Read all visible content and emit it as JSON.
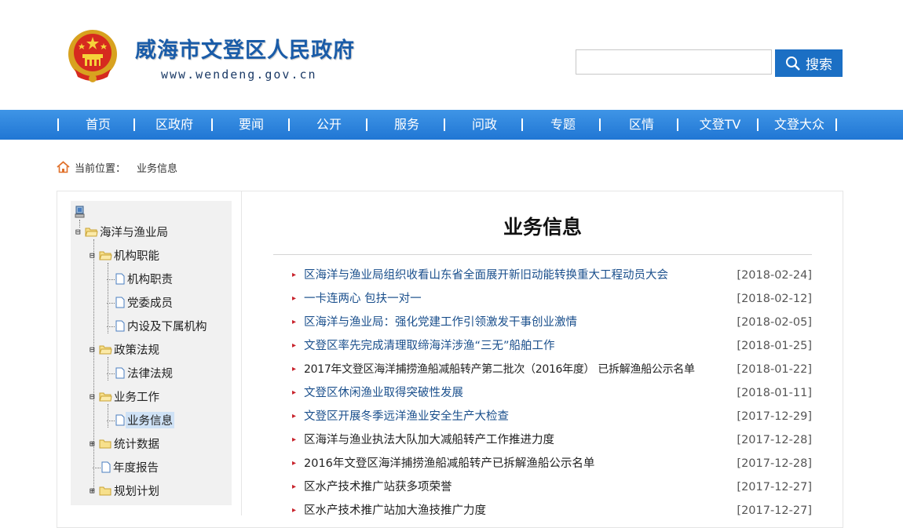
{
  "header": {
    "site_title": "威海市文登区人民政府",
    "site_url": "www.wendeng.gov.cn",
    "emblem_icon": "national-emblem-icon",
    "search": {
      "value": "",
      "placeholder": "",
      "button_label": "搜索",
      "icon": "search-icon"
    }
  },
  "nav": {
    "items": [
      "首页",
      "区政府",
      "要闻",
      "公开",
      "服务",
      "问政",
      "专题",
      "区情",
      "文登TV",
      "文登大众"
    ]
  },
  "breadcrumb": {
    "icon": "home-icon",
    "prefix": "当前位置：",
    "current": "业务信息"
  },
  "sidebar": {
    "root_icon": "computer-icon",
    "items": [
      {
        "label": "海洋与渔业局",
        "type": "folder",
        "expanded": true
      },
      {
        "label": "机构职能",
        "type": "folder",
        "expanded": true
      },
      {
        "label": "机构职责",
        "type": "page"
      },
      {
        "label": "党委成员",
        "type": "page"
      },
      {
        "label": "内设及下属机构",
        "type": "page"
      },
      {
        "label": "政策法规",
        "type": "folder",
        "expanded": true
      },
      {
        "label": "法律法规",
        "type": "page"
      },
      {
        "label": "业务工作",
        "type": "folder",
        "expanded": true
      },
      {
        "label": "业务信息",
        "type": "page",
        "selected": true
      },
      {
        "label": "统计数据",
        "type": "folder",
        "expanded": false
      },
      {
        "label": "年度报告",
        "type": "page"
      },
      {
        "label": "规划计划",
        "type": "folder",
        "expanded": false
      }
    ]
  },
  "main": {
    "title": "业务信息",
    "bullet": "▸",
    "news": [
      {
        "title": "区海洋与渔业局组织收看山东省全面展开新旧动能转换重大工程动员大会",
        "date": "[2018-02-24]"
      },
      {
        "title": "一卡连两心 包扶一对一",
        "date": "[2018-02-12]"
      },
      {
        "title": "区海洋与渔业局：强化党建工作引领激发干事创业激情",
        "date": "[2018-02-05]"
      },
      {
        "title": "文登区率先完成清理取缔海洋涉渔“三无”船舶工作",
        "date": "[2018-01-25]"
      },
      {
        "title": "2017年文登区海洋捕捞渔船减船转产第二批次（2016年度） 已拆解渔船公示名单",
        "date": "[2018-01-22]"
      },
      {
        "title": "文登区休闲渔业取得突破性发展",
        "date": "[2018-01-11]"
      },
      {
        "title": "文登区开展冬季远洋渔业安全生产大检查",
        "date": "[2017-12-29]"
      },
      {
        "title": "区海洋与渔业执法大队加大减船转产工作推进力度",
        "date": "[2017-12-28]"
      },
      {
        "title": "2016年文登区海洋捕捞渔船减船转产已拆解渔船公示名单",
        "date": "[2017-12-28]"
      },
      {
        "title": "区水产技术推广站获多项荣誉",
        "date": "[2017-12-27]"
      },
      {
        "title": "区水产技术推广站加大渔技推广力度",
        "date": "[2017-12-27]"
      }
    ]
  },
  "colors": {
    "nav_blue": "#2a84dc",
    "title_blue": "#1a5ca8",
    "link_blue": "#1a4f8c",
    "bullet_red": "#c8232c",
    "selected_bg": "#cfe2f6"
  }
}
